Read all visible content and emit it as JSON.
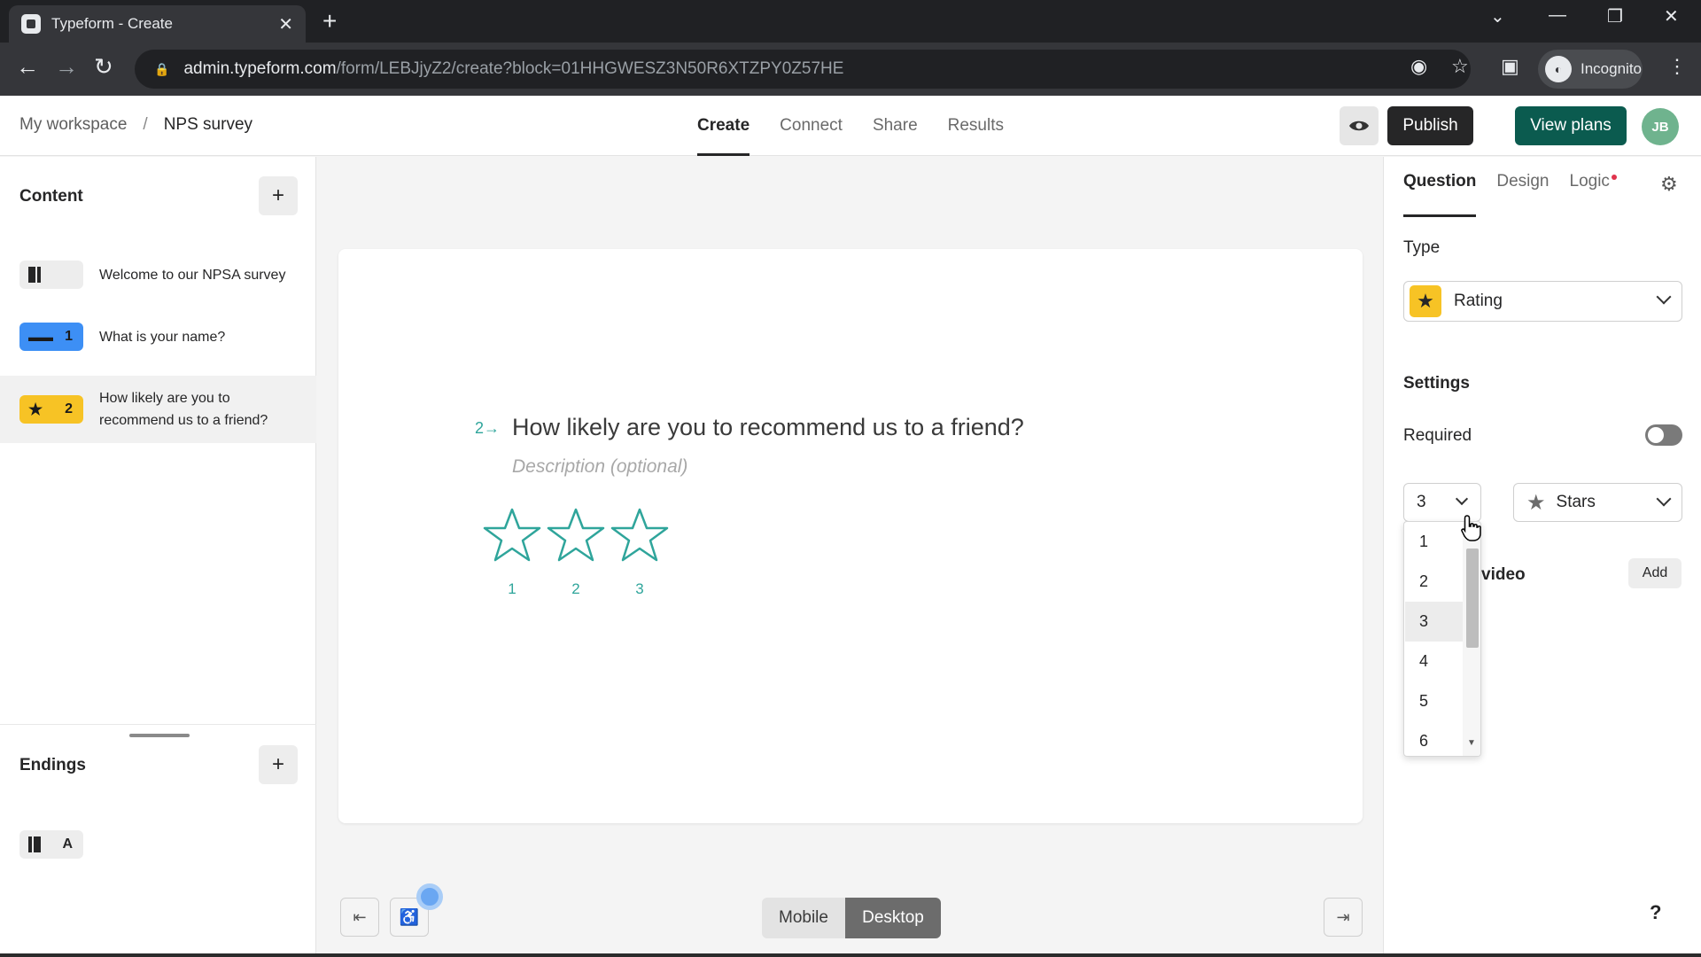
{
  "browser": {
    "tab_title": "Typeform - Create",
    "url_host": "admin.typeform.com",
    "url_path": "/form/LEBJjyZ2/create?block=01HHGWESZ3N50R6XTZPY0Z57HE",
    "profile_label": "Incognito"
  },
  "header": {
    "breadcrumb_root": "My workspace",
    "breadcrumb_sep": "/",
    "breadcrumb_current": "NPS survey",
    "tabs": [
      "Create",
      "Connect",
      "Share",
      "Results"
    ],
    "publish_label": "Publish",
    "view_plans_label": "View plans",
    "avatar_initials": "JB"
  },
  "sidebar": {
    "content_title": "Content",
    "items": [
      {
        "badge": "",
        "label": "Welcome to our NPSA survey"
      },
      {
        "badge": "1",
        "label": "What is your name?"
      },
      {
        "badge": "2",
        "label": "How likely are you to recommend us to a friend?"
      }
    ],
    "endings_title": "Endings",
    "ending_badge": "A"
  },
  "canvas": {
    "question_number": "2",
    "question_title": "How likely are you to recommend us to a friend?",
    "description_placeholder": "Description (optional)",
    "star_labels": [
      "1",
      "2",
      "3"
    ],
    "view_mobile": "Mobile",
    "view_desktop": "Desktop"
  },
  "panel": {
    "tabs": [
      "Question",
      "Design",
      "Logic"
    ],
    "type_label": "Type",
    "type_value": "Rating",
    "settings_label": "Settings",
    "required_label": "Required",
    "required_on": false,
    "steps_value": "3",
    "shape_value": "Stars",
    "image_video_label": "video",
    "add_label": "Add",
    "help_label": "?"
  },
  "steps_dropdown": {
    "options": [
      "1",
      "2",
      "3",
      "4",
      "5",
      "6"
    ],
    "selected": "3"
  },
  "colors": {
    "accent_teal": "#2fa59b",
    "rating_yellow": "#f7c325",
    "text_blue": "#3d8ff5",
    "view_plans_green": "#0b5b4f",
    "logic_dot_red": "#e0334c"
  }
}
